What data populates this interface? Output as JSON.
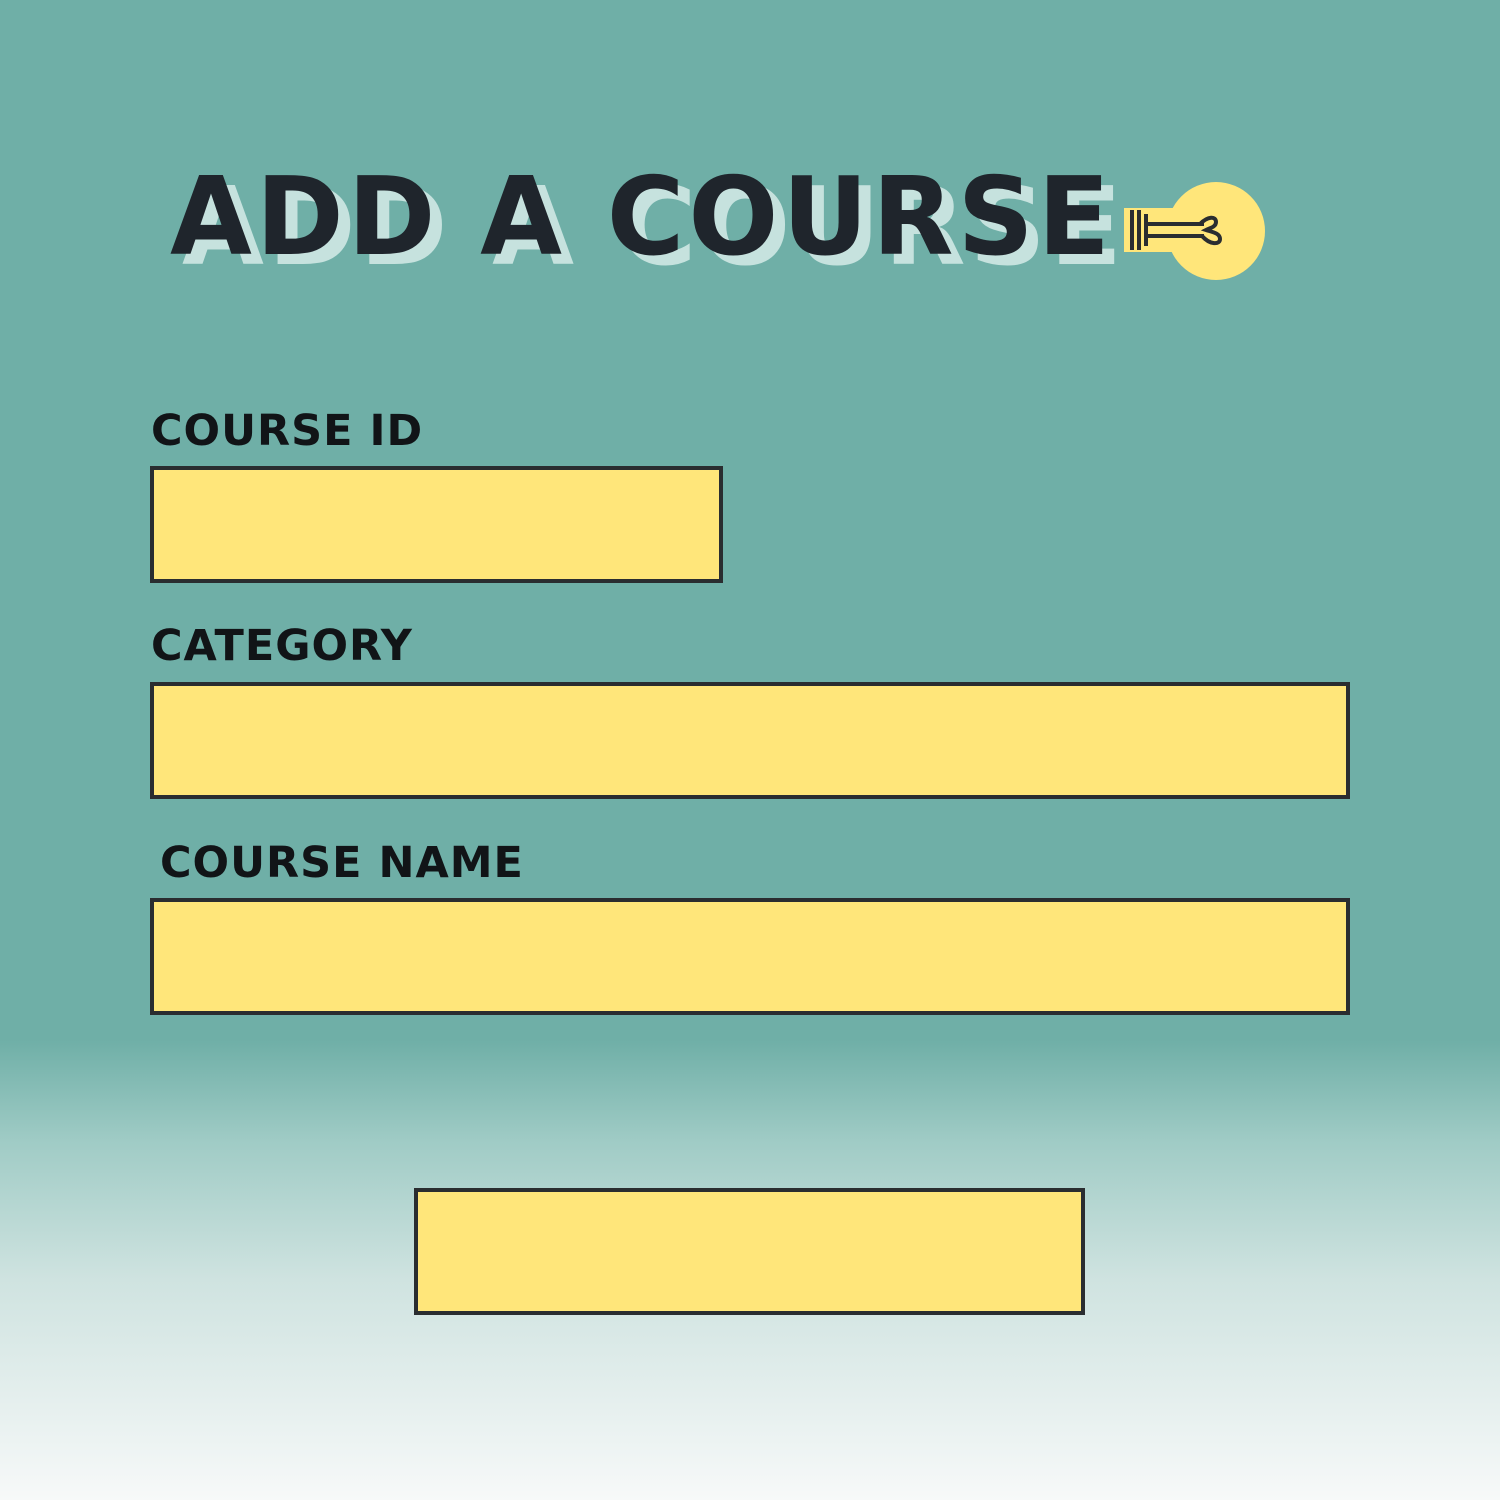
{
  "header": {
    "title": "ADD A COURSE",
    "icon": "lightbulb-icon"
  },
  "form": {
    "fields": [
      {
        "label": "COURSE ID",
        "value": "",
        "placeholder": ""
      },
      {
        "label": "CATEGORY",
        "value": "",
        "placeholder": ""
      },
      {
        "label": "COURSE NAME",
        "value": "",
        "placeholder": ""
      }
    ],
    "submit_label": ""
  },
  "colors": {
    "background_top": "#6fafa7",
    "background_bottom": "#f7f9f9",
    "input_fill": "#ffe67a",
    "input_border": "#2a2d30",
    "title_text": "#1f252c",
    "title_shadow": "#c6e2de",
    "label_text": "#111417",
    "bulb_fill": "#ffe67a"
  }
}
